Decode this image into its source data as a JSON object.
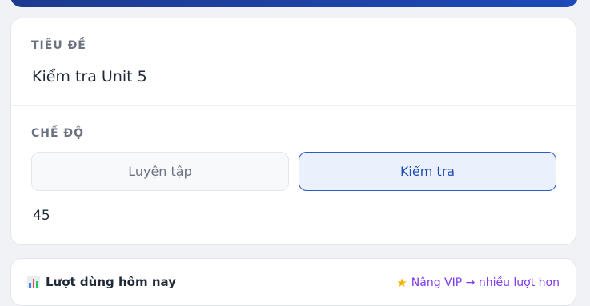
{
  "form": {
    "title_label": "TIÊU ĐỀ",
    "title_value": "Kiểm tra Unit 5",
    "mode_label": "CHẾ ĐỘ",
    "mode_options": [
      "Luyện tập",
      "Kiểm tra"
    ],
    "selected_mode": "Kiểm tra",
    "number_value": "45"
  },
  "usage": {
    "title": "Lượt dùng hôm nay",
    "vip_link": "Nâng VIP → nhiều lượt hơn"
  },
  "icons": {
    "usage": "bar-chart-icon",
    "vip": "star-icon"
  },
  "colors": {
    "accent": "#1e4fb0",
    "banner_start": "#1d3a8f",
    "banner_end": "#1e49b8",
    "vip_link": "#7c3aed"
  }
}
